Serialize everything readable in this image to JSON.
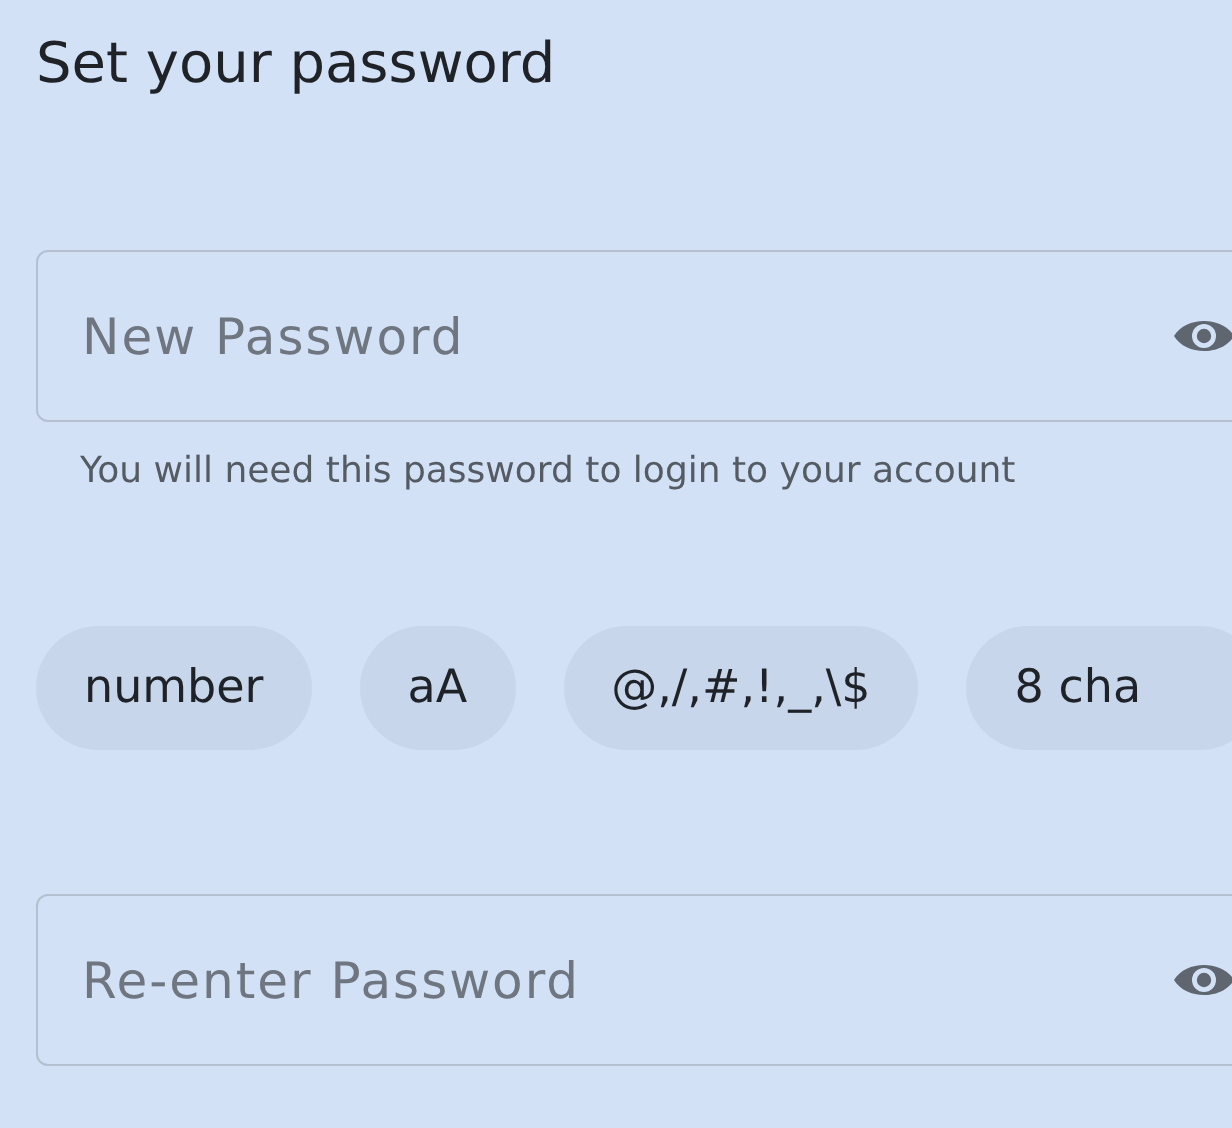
{
  "title": "Set your password",
  "new_password": {
    "placeholder": "New Password",
    "helper": "You will need this password to login to your account"
  },
  "requirements": [
    {
      "label": "number"
    },
    {
      "label": "aA"
    },
    {
      "label": "@,/,#,!,_,\\$"
    },
    {
      "label": "8 cha"
    }
  ],
  "confirm_password": {
    "placeholder": "Re-enter Password"
  }
}
